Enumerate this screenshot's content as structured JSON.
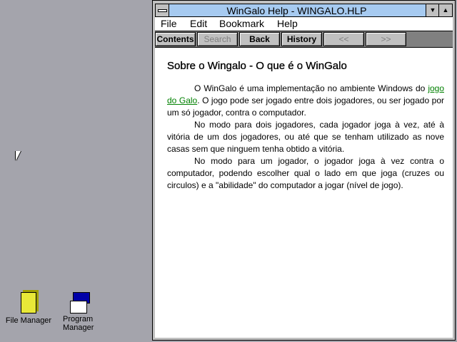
{
  "window": {
    "title": "WinGalo Help - WINGALO.HLP"
  },
  "menu": [
    "File",
    "Edit",
    "Bookmark",
    "Help"
  ],
  "toolbar": {
    "contents": "Contents",
    "search": "Search",
    "back": "Back",
    "history": "History",
    "prev": "<<",
    "next": ">>"
  },
  "topic": {
    "heading": "Sobre o Wingalo - O que é o WinGalo",
    "p1_a": "O WinGalo é uma implementação no ambiente Windows do ",
    "p1_link": "jogo do Galo",
    "p1_b": ". O jogo pode ser jogado entre dois jogadores, ou ser jogado por um só jogador, contra o computador.",
    "p2": "No modo para dois jogadores, cada jogador joga à vez, até à vitória de um dos jogadores, ou até que se tenham utilizado as nove casas sem que ninguem tenha obtido a vitória.",
    "p3": "No modo para um jogador, o jogador joga à vez contra o computador, podendo escolher qual o lado em que joga (cruzes ou circulos) e a \"abilidade\" do computador a jogar (nível de jogo)."
  },
  "desktop": {
    "file_manager": "File Manager",
    "program_manager": "Program Manager"
  }
}
